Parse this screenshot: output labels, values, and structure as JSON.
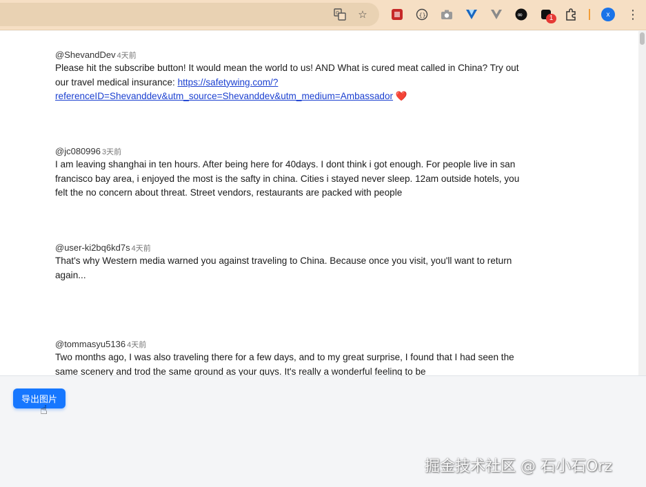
{
  "browser": {
    "toolbar_icons": [
      "translate-icon",
      "star-icon",
      "extension-red-icon",
      "code-icon",
      "camera-icon",
      "vuetify-icon",
      "vue-icon",
      "infinity-icon",
      "extension-badge-icon",
      "puzzle-icon",
      "avatar",
      "menu-icon"
    ],
    "badge_count": "1",
    "avatar_letter": "x"
  },
  "comments": [
    {
      "author": "@ShevandDev",
      "time": "4天前",
      "text_before_link": "Please hit the subscribe button! It would mean the world to us! AND What is cured meat called in China? Try out our travel medical insurance: ",
      "link": "https://safetywing.com/?referenceID=Shevanddev&utm_source=Shevanddev&utm_medium=Ambassador",
      "text_after_link": "❤️"
    },
    {
      "author": "@jc080996",
      "time": "3天前",
      "text": "I am leaving shanghai in ten hours. After being here for 40days. I dont think i got enough. For people live in san francisco bay area, i enjoyed the most is the safty in china. Cities i stayed never sleep. 12am outside hotels, you felt the no concern about threat. Street vendors, restaurants are packed with people"
    },
    {
      "author": "@user-ki2bq6kd7s",
      "time": "4天前",
      "text": "That's why Western media warned you against traveling to China. Because once you visit, you'll want to return again..."
    },
    {
      "author": "@tommasyu5136",
      "time": "4天前",
      "text": "Two months ago, I was also traveling there for a few days, and to my great surprise, I found that I had seen the same scenery and trod the same ground as your guys. It's really a wonderful feeling to be"
    }
  ],
  "export_button": "导出图片",
  "watermark": "掘金技术社区 @ 石小石Orz",
  "colors": {
    "accent": "#1677ff",
    "toolbar": "#f6dfc4",
    "link": "#1a3fd0"
  }
}
